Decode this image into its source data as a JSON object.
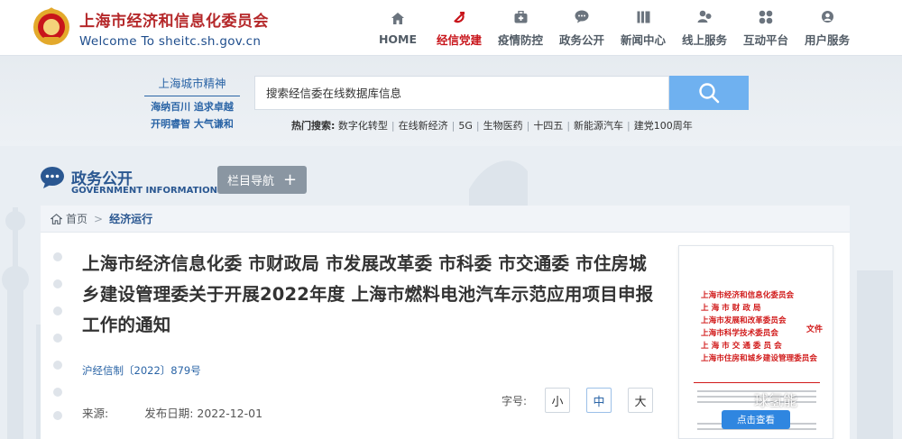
{
  "header": {
    "site_name_cn": "上海市经济和信息化委员会",
    "site_name_en": "Welcome To sheitc.sh.gov.cn",
    "nav": [
      {
        "label": "HOME",
        "icon": "home-icon",
        "active": false
      },
      {
        "label": "经信党建",
        "icon": "party-emblem-icon",
        "active": true
      },
      {
        "label": "疫情防控",
        "icon": "medical-kit-icon",
        "active": false
      },
      {
        "label": "政务公开",
        "icon": "chat-bubble-icon",
        "active": false
      },
      {
        "label": "新闻中心",
        "icon": "news-icon",
        "active": false
      },
      {
        "label": "线上服务",
        "icon": "user-service-icon",
        "active": false
      },
      {
        "label": "互动平台",
        "icon": "interaction-icon",
        "active": false
      },
      {
        "label": "用户服务",
        "icon": "user-icon",
        "active": false
      }
    ]
  },
  "search": {
    "spirit_title": "上海城市精神",
    "spirit_line1": "海纳百川 追求卓越",
    "spirit_line2": "开明睿智 大气谦和",
    "placeholder": "搜索经信委在线数据库信息",
    "hot_label": "热门搜索:",
    "hot_keywords": [
      "数字化转型",
      "在线新经济",
      "5G",
      "生物医药",
      "十四五",
      "新能源汽车",
      "建党100周年"
    ]
  },
  "section": {
    "title_cn": "政务公开",
    "title_en": "GOVERNMENT INFORMATION",
    "column_nav_label": "栏目导航",
    "column_nav_icon": "plus-icon"
  },
  "breadcrumb": {
    "home": "首页",
    "separator": ">",
    "current": "经济运行"
  },
  "article": {
    "title": "上海市经济信息化委 市财政局 市发展改革委 市科委 市交通委 市住房城乡建设管理委关于开展2022年度 上海市燃料电池汽车示范应用项目申报工作的通知",
    "doc_number": "沪经信制〔2022〕879号",
    "source_label": "来源:",
    "source_value": "",
    "date_label": "发布日期:",
    "date_value": "2022-12-01",
    "font_size_label": "字号:",
    "font_sizes": [
      "小",
      "中",
      "大"
    ],
    "font_size_selected": "中"
  },
  "document_preview": {
    "issuers": [
      "上海市经济和信息化委员会",
      "上 海 市 财 政 局",
      "上海市发展和改革委员会",
      "上海市科学技术委员会",
      "上 海 市 交 通 委 员 会",
      "上海市住房和城乡建设管理委员会"
    ],
    "suffix": "文件",
    "view_button": "点击查看"
  },
  "watermark": {
    "text": "球氢能"
  },
  "colors": {
    "brand_red": "#b5282a",
    "brand_blue": "#1e4d8c",
    "nav_active": "#c8151b",
    "search_button": "#6fb1f0",
    "link_blue": "#2a64a6",
    "doc_red": "#d11a1a"
  }
}
